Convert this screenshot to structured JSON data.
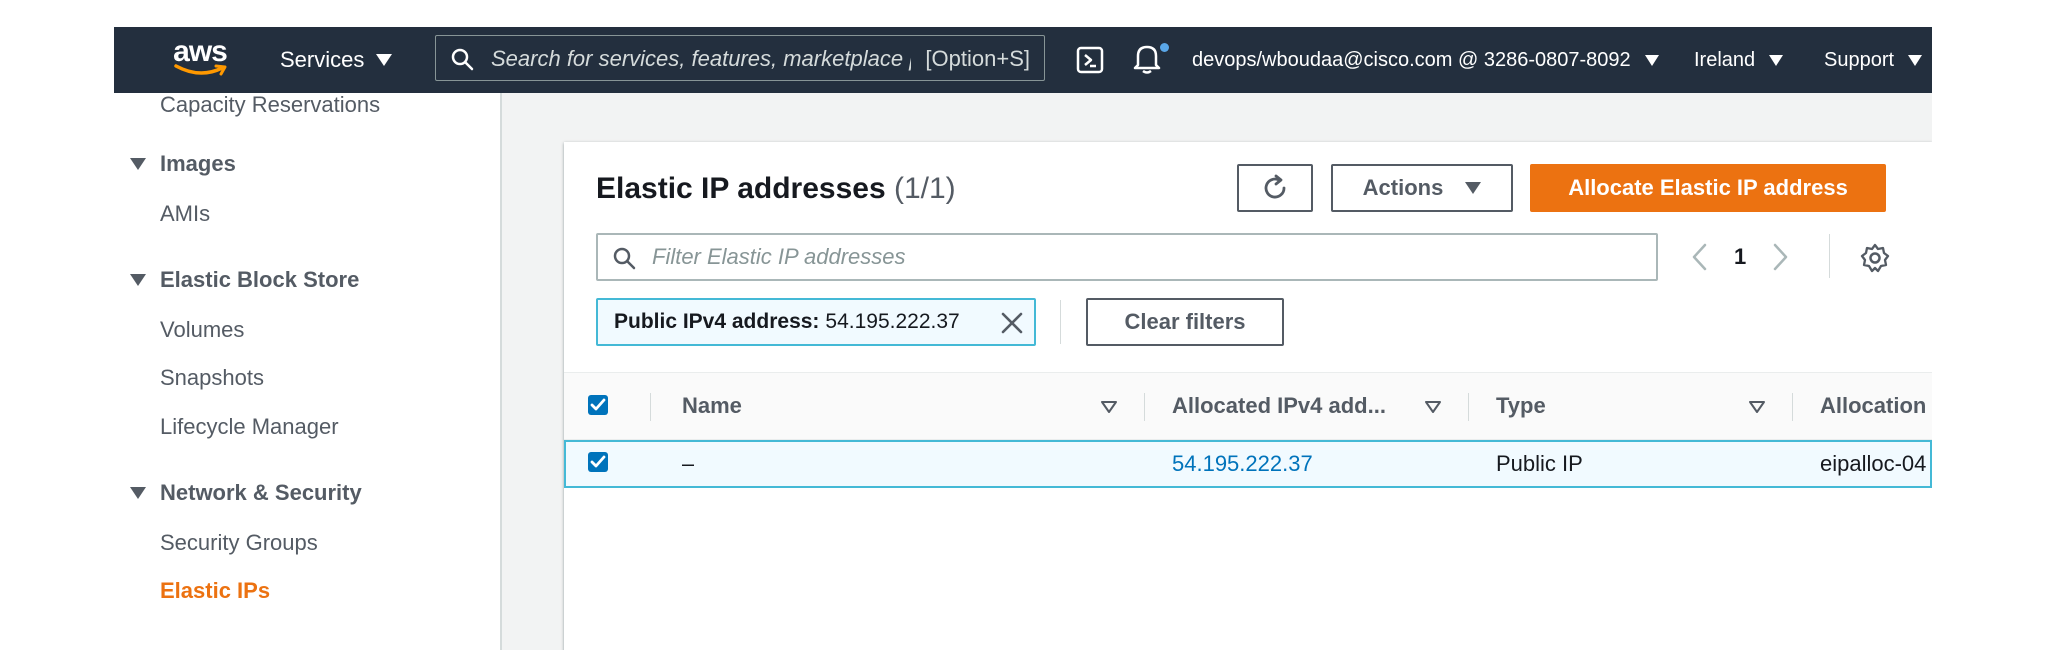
{
  "topnav": {
    "logo_text": "aws",
    "services_label": "Services",
    "search_placeholder": "Search for services, features, marketplace products, and docs",
    "search_shortcut": "[Option+S]",
    "account_label": "devops/wboudaa@cisco.com @ 3286-0807-8092",
    "region_label": "Ireland",
    "support_label": "Support"
  },
  "sidebar": {
    "partial_top_item": "Capacity Reservations",
    "sections": [
      {
        "heading": "Images",
        "items": [
          "AMIs"
        ]
      },
      {
        "heading": "Elastic Block Store",
        "items": [
          "Volumes",
          "Snapshots",
          "Lifecycle Manager"
        ]
      },
      {
        "heading": "Network & Security",
        "items": [
          "Security Groups",
          "Elastic IPs"
        ]
      }
    ],
    "active_item": "Elastic IPs"
  },
  "panel": {
    "title": "Elastic IP addresses",
    "count": "(1/1)",
    "actions_label": "Actions",
    "allocate_label": "Allocate Elastic IP address",
    "filter_placeholder": "Filter Elastic IP addresses",
    "page_number": "1",
    "filter_token": {
      "label": "Public IPv4 address:",
      "value": "54.195.222.37"
    },
    "clear_filters_label": "Clear filters"
  },
  "table": {
    "columns": [
      "Name",
      "Allocated IPv4 add...",
      "Type",
      "Allocation"
    ],
    "rows": [
      {
        "name": "–",
        "ip": "54.195.222.37",
        "type": "Public IP",
        "allocation": "eipalloc-04"
      }
    ]
  },
  "colors": {
    "accent": "#ec7211",
    "nav_bg": "#232f3e",
    "link": "#0073bb",
    "selection_border": "#44b9d6"
  }
}
